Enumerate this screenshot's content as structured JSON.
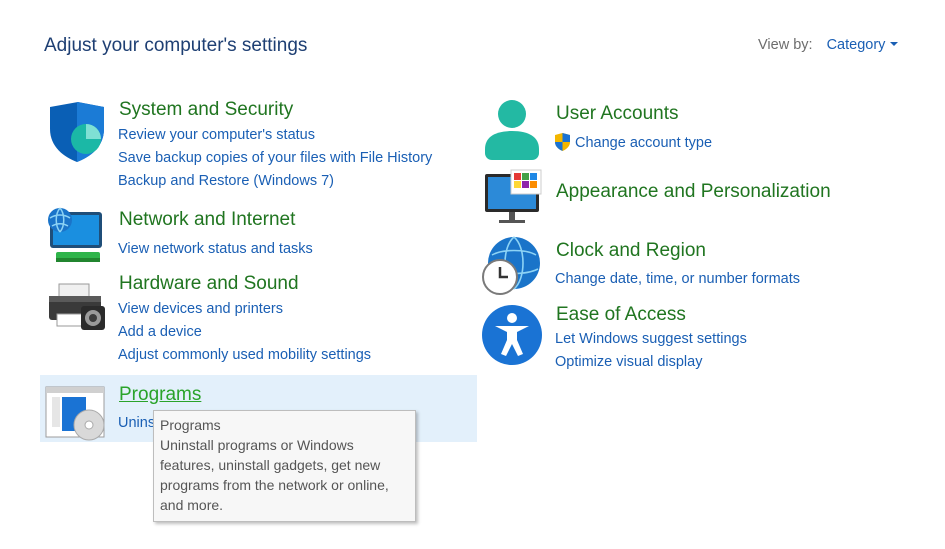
{
  "header": {
    "title": "Adjust your computer's settings",
    "view_by_label": "View by:",
    "view_by_value": "Category"
  },
  "categories": {
    "system_security": {
      "title": "System and Security",
      "links": [
        "Review your computer's status",
        "Save backup copies of your files with File History",
        "Backup and Restore (Windows 7)"
      ]
    },
    "network": {
      "title": "Network and Internet",
      "links": [
        "View network status and tasks"
      ]
    },
    "hardware": {
      "title": "Hardware and Sound",
      "links": [
        "View devices and printers",
        "Add a device",
        "Adjust commonly used mobility settings"
      ]
    },
    "programs": {
      "title": "Programs",
      "links": [
        "Unins"
      ]
    },
    "user_accounts": {
      "title": "User Accounts",
      "links": [
        "Change account type"
      ]
    },
    "appearance": {
      "title": "Appearance and Personalization"
    },
    "clock": {
      "title": "Clock and Region",
      "links": [
        "Change date, time, or number formats"
      ]
    },
    "ease": {
      "title": "Ease of Access",
      "links": [
        "Let Windows suggest settings",
        "Optimize visual display"
      ]
    }
  },
  "tooltip": {
    "title": "Programs",
    "body": "Uninstall programs or Windows features, uninstall gadgets, get new programs from the network or online, and more."
  },
  "colors": {
    "title_blue": "#1e3f73",
    "link_blue": "#1a5fb4",
    "category_green": "#207520",
    "hover_background": "#e3f0fb"
  }
}
